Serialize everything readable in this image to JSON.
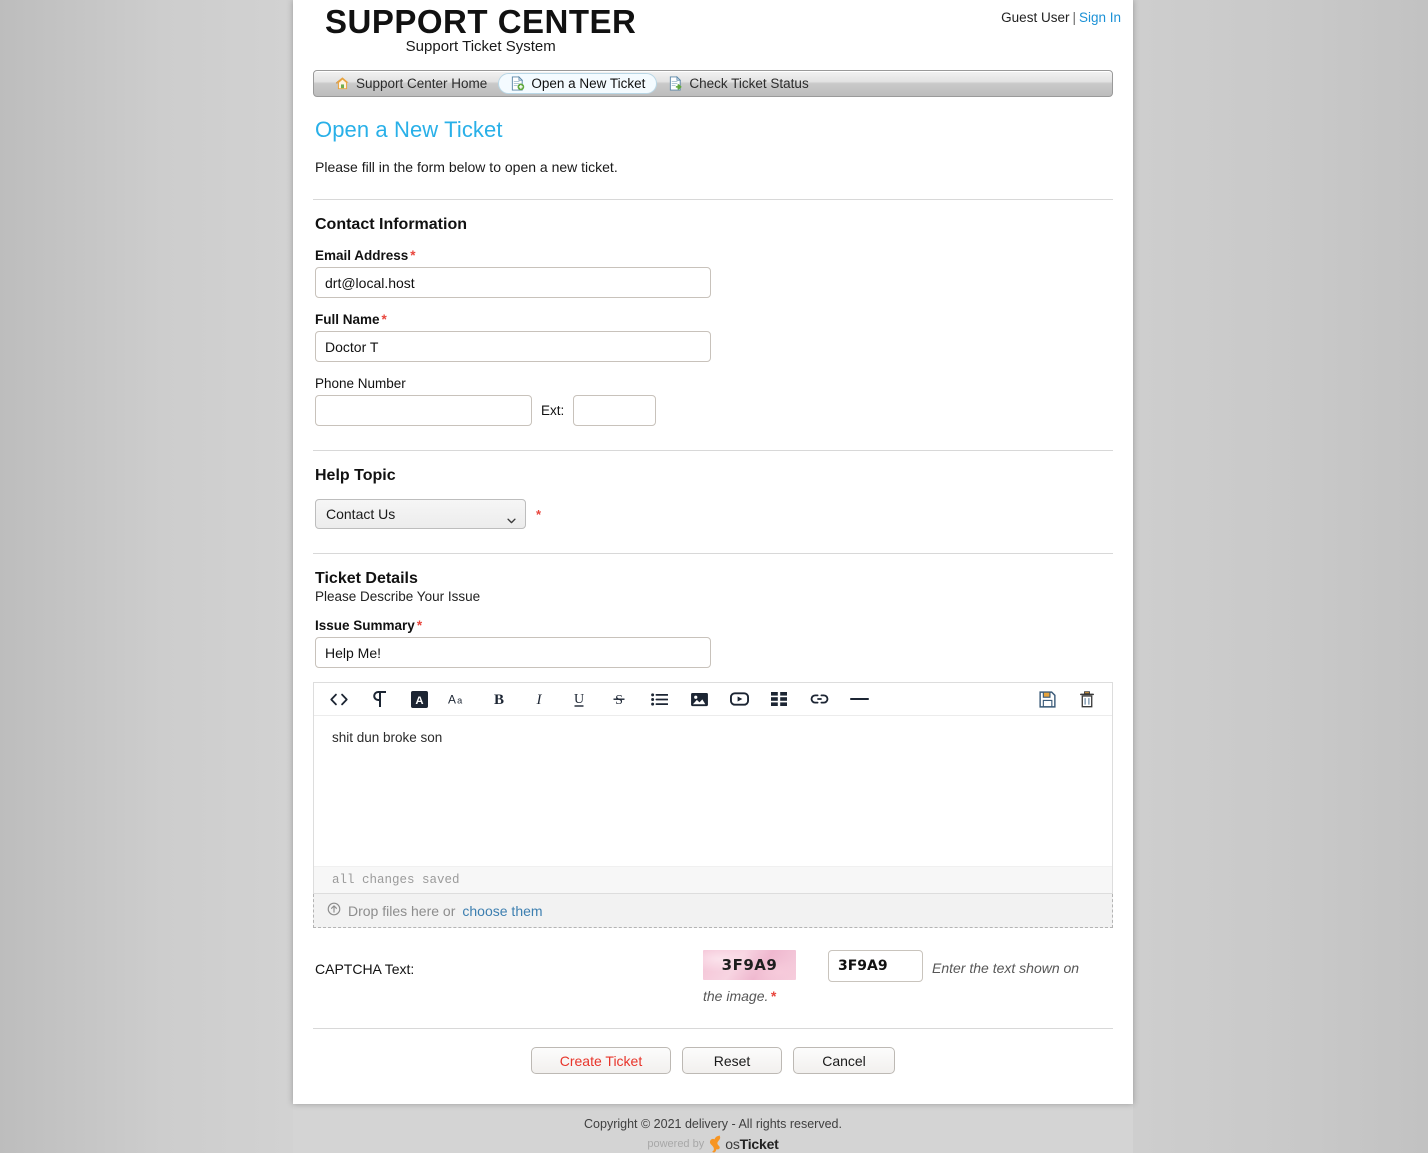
{
  "header": {
    "brand_title": "SUPPORT CENTER",
    "brand_subtitle": "Support Ticket System",
    "user_label": "Guest User",
    "separator": "|",
    "sign_in": "Sign In"
  },
  "nav": {
    "tabs": [
      {
        "label": "Support Center Home",
        "icon": "home-icon",
        "active": false
      },
      {
        "label": "Open a New Ticket",
        "icon": "new-ticket-icon",
        "active": true
      },
      {
        "label": "Check Ticket Status",
        "icon": "check-status-icon",
        "active": false
      }
    ]
  },
  "page": {
    "title": "Open a New Ticket",
    "lede": "Please fill in the form below to open a new ticket."
  },
  "contact": {
    "heading": "Contact Information",
    "email_label": "Email Address",
    "email_value": "drt@local.host",
    "name_label": "Full Name",
    "name_value": "Doctor T",
    "phone_label": "Phone Number",
    "phone_value": "",
    "ext_label": "Ext:",
    "ext_value": "",
    "required_mark": "*"
  },
  "help_topic": {
    "label": "Help Topic",
    "selected": "Contact Us",
    "required_mark": "*"
  },
  "ticket_details": {
    "heading": "Ticket Details",
    "subheading": "Please Describe Your Issue",
    "summary_label": "Issue Summary",
    "summary_value": "Help Me!",
    "required_mark": "*"
  },
  "editor": {
    "toolbar_left": [
      {
        "name": "source-code-icon",
        "title": "<>"
      },
      {
        "name": "paragraph-icon",
        "title": "¶"
      },
      {
        "name": "text-color-icon",
        "title": "A"
      },
      {
        "name": "font-size-icon",
        "title": "Aa"
      },
      {
        "name": "bold-icon",
        "title": "B"
      },
      {
        "name": "italic-icon",
        "title": "I"
      },
      {
        "name": "underline-icon",
        "title": "U"
      },
      {
        "name": "strikethrough-icon",
        "title": "S"
      },
      {
        "name": "bullet-list-icon",
        "title": "list"
      },
      {
        "name": "image-icon",
        "title": "image"
      },
      {
        "name": "video-icon",
        "title": "video"
      },
      {
        "name": "table-icon",
        "title": "table"
      },
      {
        "name": "link-icon",
        "title": "link"
      },
      {
        "name": "horizontal-rule-icon",
        "title": "hr"
      }
    ],
    "toolbar_right": [
      {
        "name": "save-draft-icon",
        "title": "save"
      },
      {
        "name": "delete-draft-icon",
        "title": "delete"
      }
    ],
    "body_text": "shit dun broke son",
    "status_text": "all changes saved"
  },
  "dropzone": {
    "prompt": "Drop files here or",
    "link": "choose them",
    "icon": "upload-circle-icon"
  },
  "captcha": {
    "label": "CAPTCHA Text:",
    "image_text": "3F9A9",
    "input_value": "3F9A9",
    "hint_line1": "Enter the text shown on",
    "hint_line2": "the image.",
    "required_mark": "*"
  },
  "actions": {
    "create": "Create Ticket",
    "reset": "Reset",
    "cancel": "Cancel"
  },
  "footer": {
    "copyright": "Copyright © 2021 delivery - All rights reserved.",
    "powered_by": "powered by",
    "logo_light": "os",
    "logo_bold": "Ticket"
  },
  "colors": {
    "accent_blue": "#29b0e8",
    "link_blue": "#1b91d6",
    "required_red": "#e8453c",
    "create_red": "#e8352b",
    "page_bg": "#c6c6c6"
  }
}
